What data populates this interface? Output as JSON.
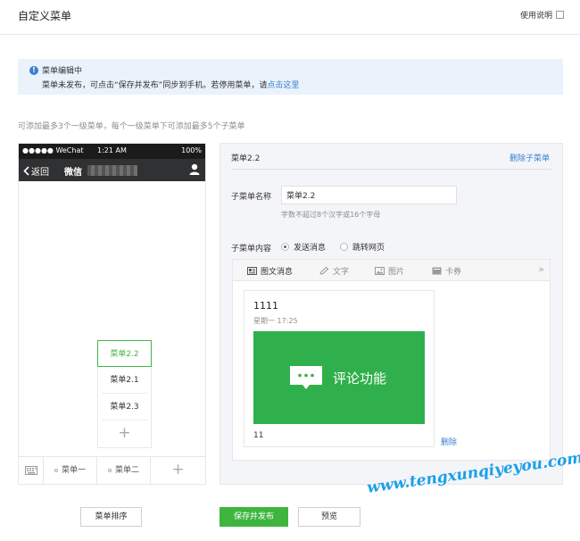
{
  "header": {
    "title": "自定义菜单",
    "help_label": "使用说明"
  },
  "notice": {
    "title": "菜单编辑中",
    "body_prefix": "菜单未发布，可点击“保存并发布”同步到手机。若停用菜单，请",
    "link_text": "点击这里"
  },
  "hint": "可添加最多3个一级菜单，每个一级菜单下可添加最多5个子菜单",
  "phone": {
    "status_left": "●●●●● WeChat",
    "status_time": "1:21 AM",
    "status_right": "100%",
    "back_label": "返回",
    "nav_title": "微信",
    "submenu": [
      "菜单2.2",
      "菜单2.1",
      "菜单2.3"
    ],
    "menus": [
      "菜单一",
      "菜单二"
    ]
  },
  "editor": {
    "title": "菜单2.2",
    "delete_label": "删除子菜单",
    "name_label": "子菜单名称",
    "name_value": "菜单2.2",
    "name_tip": "字数不超过8个汉字或16个字母",
    "content_label": "子菜单内容",
    "radio_send": "发送消息",
    "radio_jump": "跳转网页",
    "tabs": [
      "图文消息",
      "文字",
      "图片",
      "卡券"
    ],
    "card": {
      "title": "1111",
      "date": "星期一 17:25",
      "cover_text": "评论功能",
      "digest": "11",
      "delete_label": "删除"
    }
  },
  "footer": {
    "sort_label": "菜单排序",
    "publish_label": "保存并发布",
    "preview_label": "预览"
  },
  "watermark": "www.tengxunqiyeyou.com",
  "colors": {
    "accent_green": "#44b549",
    "link_blue": "#3a7ed1",
    "cover_green": "#2fb04c"
  }
}
